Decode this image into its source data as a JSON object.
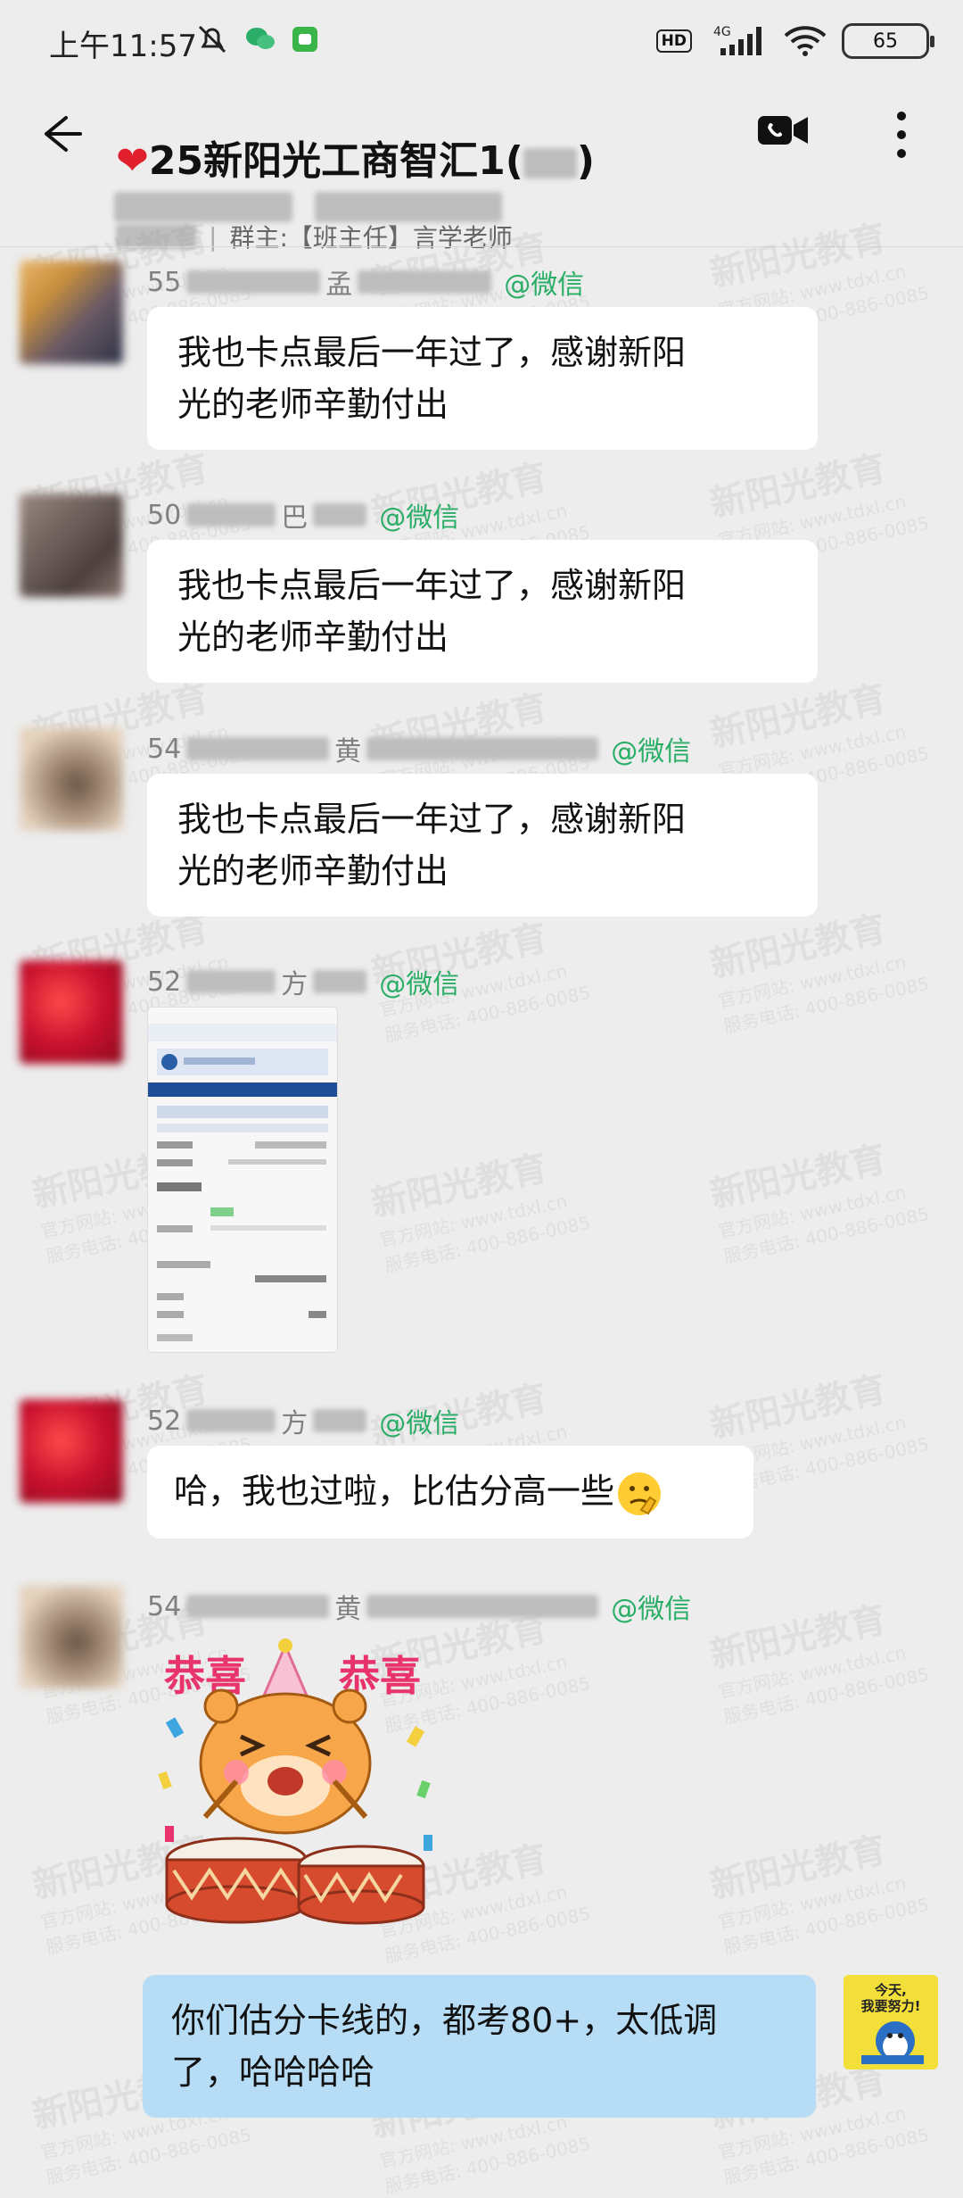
{
  "status": {
    "time": "上午11:57",
    "network": "4G",
    "battery": "65"
  },
  "header": {
    "title": "25新阳光工商智汇1(",
    "title_close": ")",
    "group_owner": "群主:【班主任】言学老师"
  },
  "messages": [
    {
      "prefix": "55",
      "name_char": "孟",
      "source": "@微信",
      "text_line1": "我也卡点最后一年过了，感谢新阳",
      "text_line2": "光的老师辛勤付出"
    },
    {
      "prefix": "50",
      "name_char": "巴",
      "source": "@微信",
      "text_line1": "我也卡点最后一年过了，感谢新阳",
      "text_line2": "光的老师辛勤付出"
    },
    {
      "prefix": "54",
      "name_char": "黄",
      "source": "@微信",
      "text_line1": "我也卡点最后一年过了，感谢新阳",
      "text_line2": "光的老师辛勤付出"
    },
    {
      "prefix": "52",
      "name_char": "方",
      "source": "@微信"
    },
    {
      "prefix": "52",
      "name_char": "方",
      "source": "@微信",
      "text": "哈，我也过啦，比估分高一些"
    },
    {
      "prefix": "54",
      "name_char": "黄",
      "source": "@微信",
      "sticker_text_left": "恭喜",
      "sticker_text_right": "恭喜"
    }
  ],
  "self_message": {
    "text_line1": "你们估分卡线的，都考80+，太低调",
    "text_line2": "了，哈哈哈哈"
  },
  "self_avatar": {
    "line1": "今天,",
    "line2": "我要努力!"
  },
  "watermark": {
    "brand": "新阳光教育",
    "site": "官方网站: www.tdxl.cn",
    "phone": "服务电话: 400-886-0085"
  },
  "colors": {
    "background": "#ededed",
    "wechat_green": "#2aae67",
    "self_bubble": "#b7dcf5",
    "heart": "#e0202c"
  }
}
